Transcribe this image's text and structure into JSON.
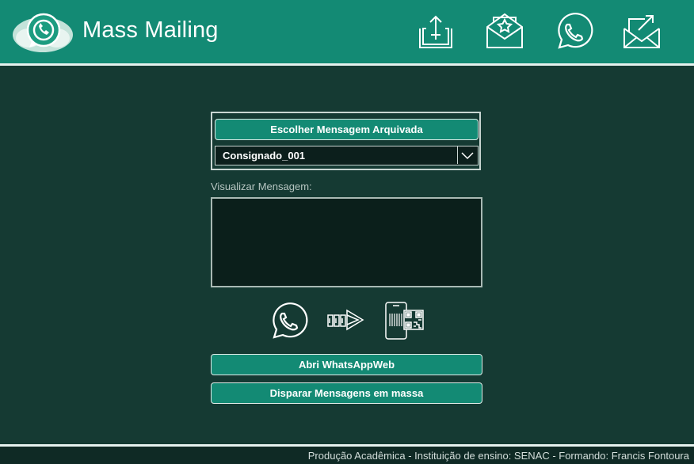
{
  "header": {
    "title": "Mass Mailing",
    "icons": [
      "whatsapp-cloud-logo",
      "upload-tray-icon",
      "envelope-star-icon",
      "whatsapp-icon",
      "send-mail-icon"
    ]
  },
  "panel": {
    "choose_button_label": "Escolher Mensagem Arquivada",
    "selected_message": "Consignado_001"
  },
  "preview": {
    "label": "Visualizar Mensagem:",
    "content": ""
  },
  "process_icons": [
    "whatsapp-icon",
    "transfer-arrows-icon",
    "phone-qr-code-icon"
  ],
  "actions": {
    "open_web_label": "Abri WhatsAppWeb",
    "send_bulk_label": "Disparar Mensagens em massa"
  },
  "footer": {
    "text": "Produção Acadêmica - Instituição de ensino: SENAC - Formando: Francis Fontoura"
  },
  "colors": {
    "header": "#138a74",
    "background": "#153a33",
    "button": "#138a74",
    "textarea": "#0b1f1b"
  }
}
